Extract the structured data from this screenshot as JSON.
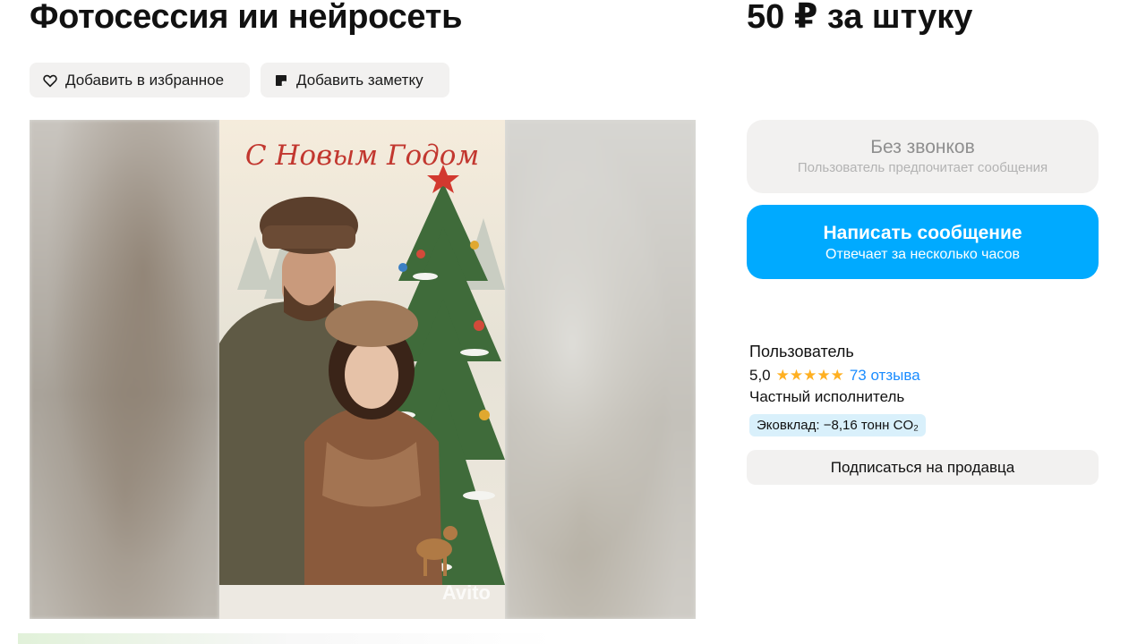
{
  "listing": {
    "title": "Фотосессия ии нейросеть",
    "price": "50 ₽ за штуку",
    "favorite_label": "Добавить в избранное",
    "note_label": "Добавить заметку"
  },
  "gallery": {
    "card_greeting": "С Новым Годом",
    "watermark": "Avito"
  },
  "contact": {
    "no_calls_title": "Без звонков",
    "no_calls_subtitle": "Пользователь предпочитает сообщения",
    "message_title": "Написать сообщение",
    "message_subtitle": "Отвечает за несколько часов"
  },
  "seller": {
    "name": "Пользователь",
    "rating": "5,0",
    "stars": "★★★★★",
    "reviews": "73 отзыва",
    "type": "Частный исполнитель",
    "eco": "Эковклад: −8,16 тонн CO₂",
    "subscribe_label": "Подписаться на продавца"
  },
  "colors": {
    "accent": "#00aaff",
    "star": "#ffb021",
    "link": "#1a8cff",
    "chip_bg": "#f2f1f0",
    "eco_bg": "#d9f0fb"
  },
  "icons": {
    "favorite": "heart-icon",
    "note": "note-icon"
  }
}
